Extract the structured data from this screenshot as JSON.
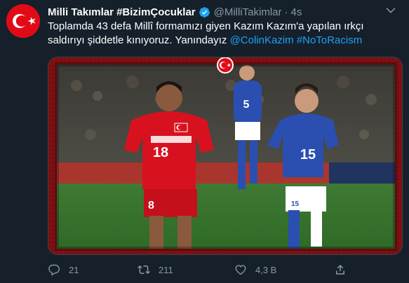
{
  "tweet": {
    "display_name": "Milli Takımlar #BizimÇocuklar",
    "handle": "@MilliTakimlar",
    "separator": "·",
    "time": "4s",
    "text_main": "Toplamda 43 defa Millî formamızı giyen Kazım Kazım'a yapılan ırkçı saldırıyı şiddetle kınıyoruz. Yanındayız ",
    "mention": "@ColinKazim",
    "hashtag": "#NoToRacism",
    "image_texts": {
      "player_left_number": "18",
      "player_left_number_shorts": "8",
      "player_right_number": "15",
      "player_right_number_shorts": "15",
      "player_back_number": "5"
    }
  },
  "actions": {
    "reply_count": "21",
    "retweet_count": "211",
    "like_count": "4,3 B"
  },
  "icons": {
    "avatar": "turkey-flag-avatar",
    "verified": "verified-badge-icon",
    "more": "more-icon",
    "reply": "reply-icon",
    "retweet": "retweet-icon",
    "like": "heart-icon",
    "share": "share-icon",
    "emblem": "turkey-flag-emblem-icon"
  },
  "colors": {
    "background": "#15202b",
    "text_primary": "#ffffff",
    "text_secondary": "#8899a6",
    "link": "#1da1f2",
    "turkey_red": "#e30a17",
    "frame_red": "#7a0f12",
    "azerbaijan_blue": "#2a4fb0"
  }
}
